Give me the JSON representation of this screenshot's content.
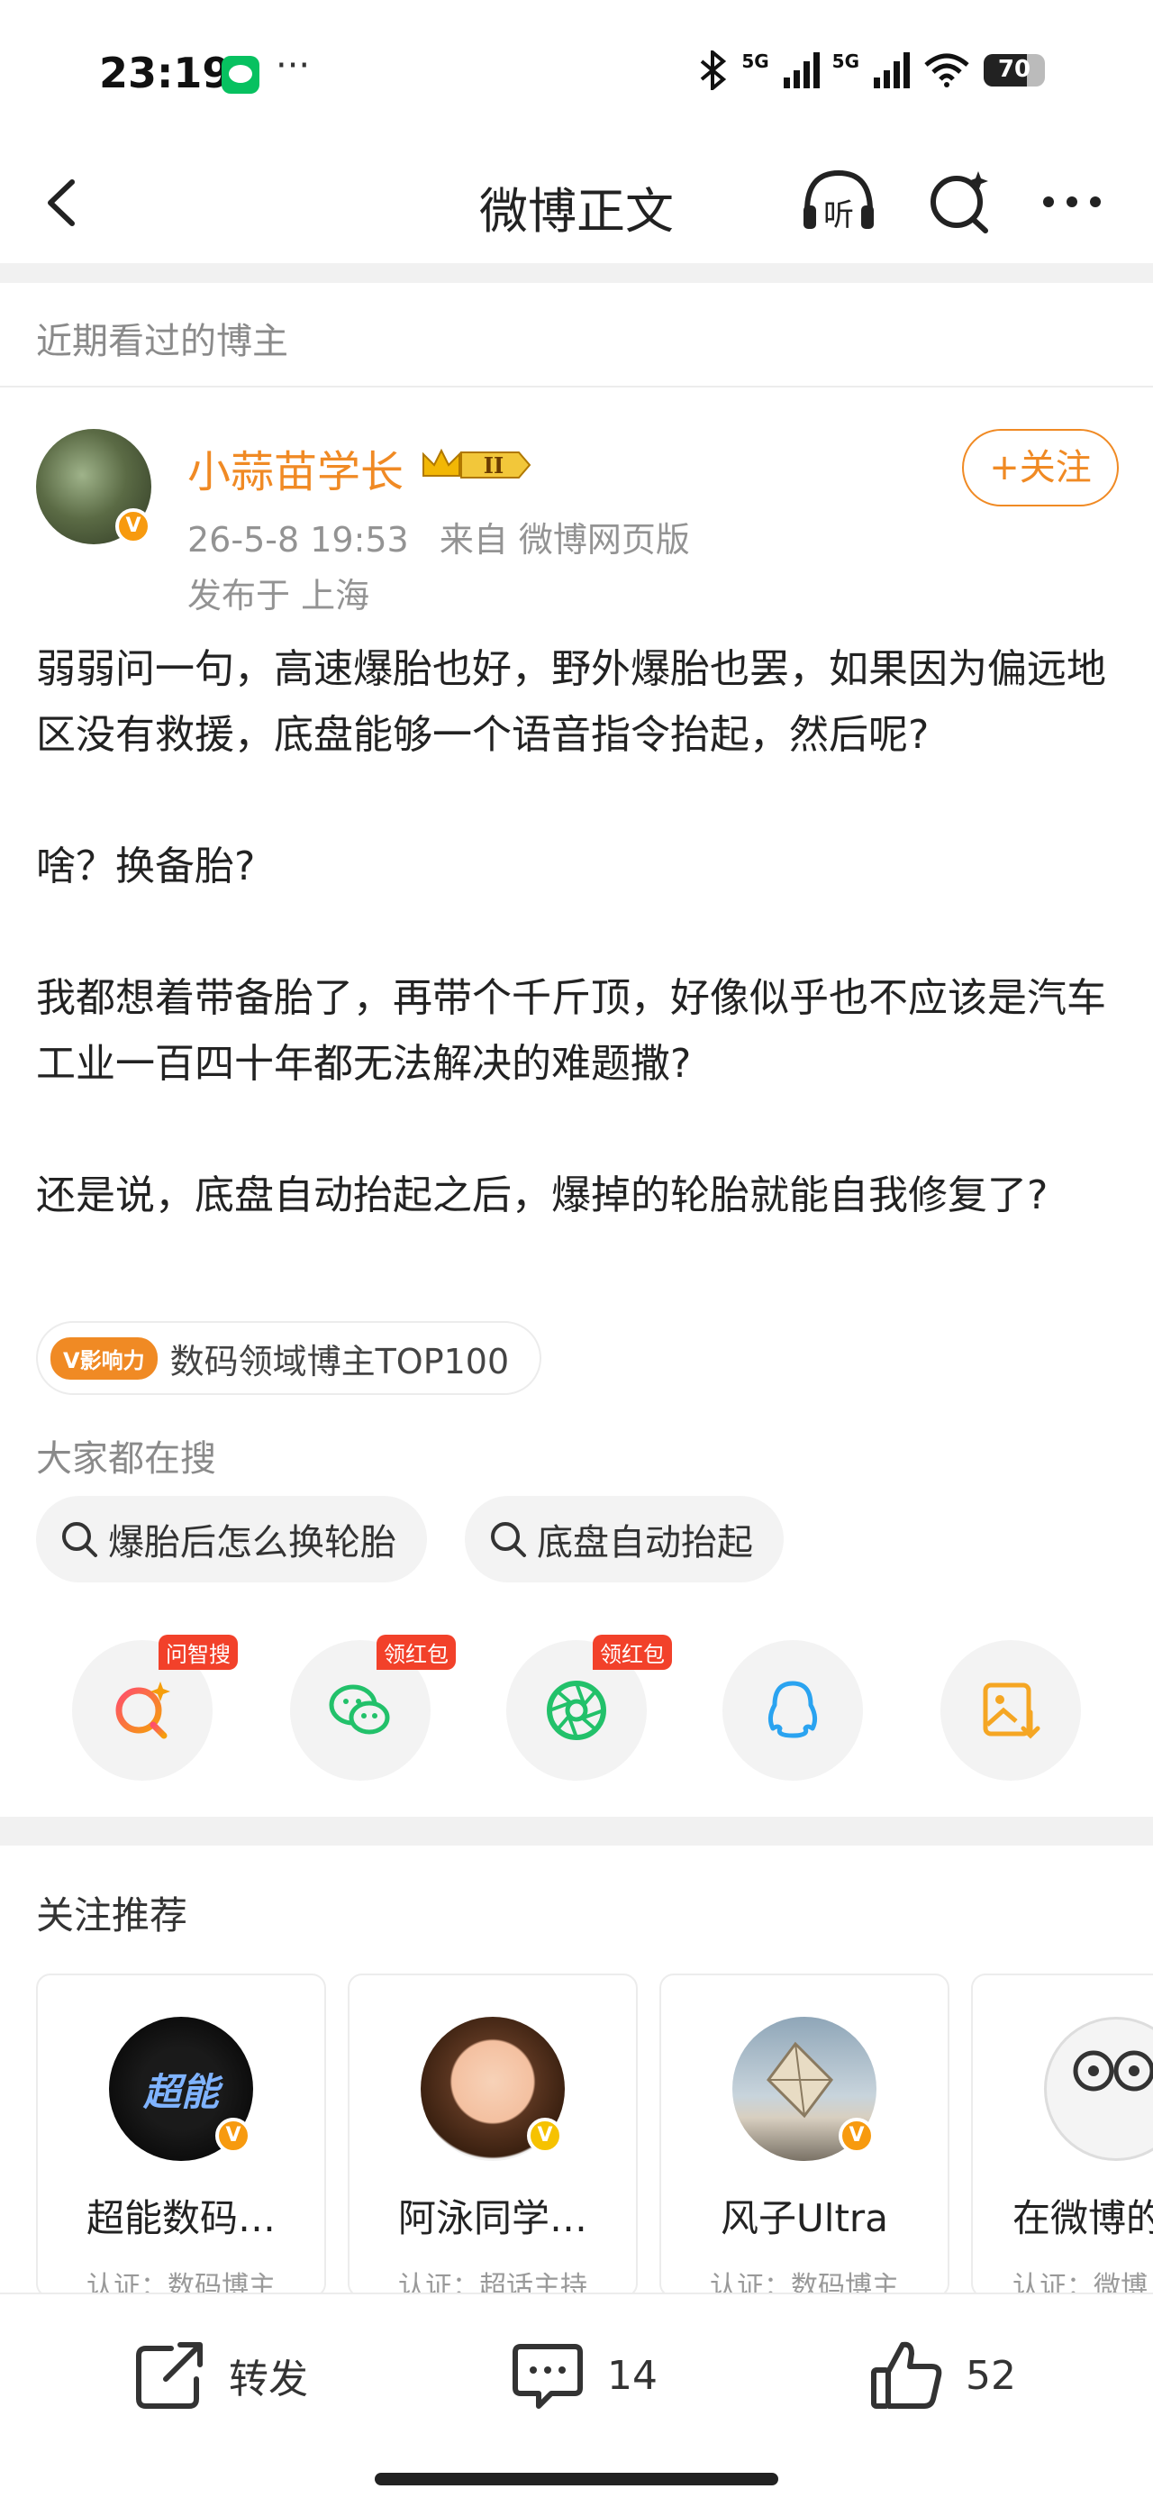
{
  "status_bar": {
    "time": "23:19",
    "more": "···",
    "signal_1": "5G",
    "signal_2": "5G",
    "battery_percent": 70,
    "battery_label": "70"
  },
  "nav": {
    "title": "微博正文",
    "listen_label": "听"
  },
  "recent_bloggers": {
    "label": "近期看过的博主"
  },
  "post": {
    "author": "小蒜苗学长",
    "level": "II",
    "follow_label": "+关注",
    "time": "26-5-8 19:53",
    "source": "来自 微博网页版",
    "location": "发布于 上海",
    "paragraphs": [
      "弱弱问一句，高速爆胎也好，野外爆胎也罢，如果因为偏远地区没有救援，底盘能够一个语音指令抬起，然后呢?",
      "啥？换备胎?",
      "我都想着带备胎了，再带个千斤顶，好像似乎也不应该是汽车工业一百四十年都无法解决的难题撒?",
      "还是说，底盘自动抬起之后，爆掉的轮胎就能自我修复了?"
    ],
    "influence_badge": "V影响力",
    "influence_text": "数码领域博主TOP100"
  },
  "hot_search": {
    "label": "大家都在搜",
    "chips": [
      "爆胎后怎么换轮胎",
      "底盘自动抬起"
    ]
  },
  "share": {
    "tags": [
      "问智搜",
      "领红包",
      "领红包"
    ],
    "icons": [
      "search-ai-icon",
      "wechat-icon",
      "moments-icon",
      "qq-icon",
      "save-image-icon"
    ]
  },
  "recommend": {
    "title": "关注推荐",
    "cards": [
      {
        "name": "超能数码…",
        "cert": "认证：数码博主",
        "avatar_text": "超能"
      },
      {
        "name": "阿泳同学…",
        "cert": "认证：超话主持",
        "avatar_text": ""
      },
      {
        "name": "风子Ultra",
        "cert": "认证：数码博主",
        "avatar_text": ""
      },
      {
        "name": "在微博的",
        "cert": "认证：微博",
        "avatar_text": ""
      }
    ]
  },
  "actions": {
    "repost_label": "转发",
    "comment_count": "14",
    "like_count": "52"
  },
  "colors": {
    "accent": "#f08a24",
    "tag_red": "#f2412a",
    "muted": "#8a8a8a"
  }
}
